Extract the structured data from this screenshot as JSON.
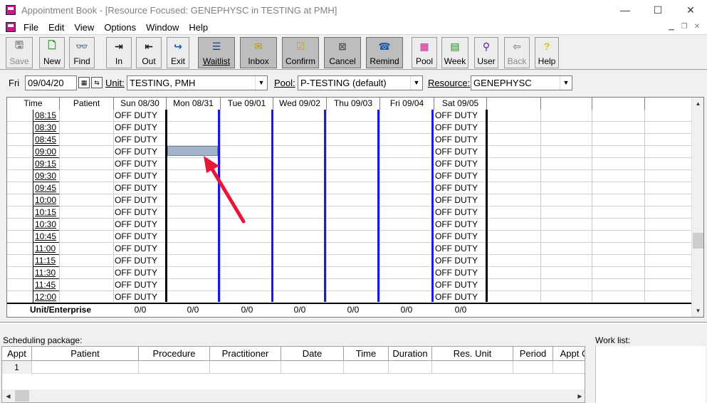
{
  "window": {
    "title": "Appointment Book - [Resource Focused:  GENEPHYSC in TESTING at PMH]",
    "minimize": "—",
    "maximize": "☐",
    "close": "✕"
  },
  "menu": [
    "File",
    "Edit",
    "View",
    "Options",
    "Window",
    "Help"
  ],
  "toolbar": [
    {
      "label": "Save",
      "icon": "save-icon",
      "state": "disabled"
    },
    {
      "label": "New",
      "icon": "new-icon",
      "state": "normal"
    },
    {
      "label": "Find",
      "icon": "binoculars-icon",
      "state": "normal"
    },
    {
      "label": "In",
      "icon": "check-in-icon",
      "state": "normal"
    },
    {
      "label": "Out",
      "icon": "check-out-icon",
      "state": "normal"
    },
    {
      "label": "Exit",
      "icon": "exit-icon",
      "state": "normal"
    },
    {
      "label": "Waitlist",
      "icon": "waitlist-icon",
      "state": "pressed"
    },
    {
      "label": "Inbox",
      "icon": "inbox-icon",
      "state": "pressed"
    },
    {
      "label": "Confirm",
      "icon": "confirm-icon",
      "state": "pressed"
    },
    {
      "label": "Cancel",
      "icon": "cancel-icon",
      "state": "pressed"
    },
    {
      "label": "Remind",
      "icon": "remind-icon",
      "state": "pressed"
    },
    {
      "label": "Pool",
      "icon": "pool-icon",
      "state": "normal"
    },
    {
      "label": "Week",
      "icon": "week-icon",
      "state": "normal"
    },
    {
      "label": "User",
      "icon": "user-icon",
      "state": "normal"
    },
    {
      "label": "Back",
      "icon": "back-icon",
      "state": "disabled"
    },
    {
      "label": "Help",
      "icon": "help-icon",
      "state": "normal"
    }
  ],
  "selection": {
    "day": "Fri",
    "date": "09/04/20",
    "unit_label": "Unit:",
    "unit_value": "TESTING, PMH",
    "pool_label": "Pool:",
    "pool_value": "P-TESTING (default)",
    "resource_label": "Resource:",
    "resource_value": "GENEPHYSC"
  },
  "grid": {
    "headers": [
      "Time",
      "Patient",
      "Sun 08/30",
      "Mon 08/31",
      "Tue 09/01",
      "Wed 09/02",
      "Thu 09/03",
      "Fri 09/04",
      "Sat 09/05",
      "",
      "",
      "",
      ""
    ],
    "times": [
      "08:15",
      "08:30",
      "08:45",
      "09:00",
      "09:15",
      "09:30",
      "09:45",
      "10:00",
      "10:15",
      "10:30",
      "10:45",
      "11:00",
      "11:15",
      "11:30",
      "11:45",
      "12:00"
    ],
    "off_duty": "OFF DUTY",
    "totals_label": "Unit/Enterprise",
    "totals": [
      "0/0",
      "0/0",
      "0/0",
      "0/0",
      "0/0",
      "0/0",
      "0/0"
    ],
    "selected_slot": {
      "day": "Mon 08/31",
      "time": "09:00"
    },
    "annotation": "red-arrow pointing to selected slot"
  },
  "scheduling": {
    "label": "Scheduling package:",
    "headers": [
      "Appt",
      "Patient",
      "Procedure",
      "Practitioner",
      "Date",
      "Time",
      "Duration",
      "Res. Unit",
      "Period",
      "Appt C"
    ],
    "row_number": "1"
  },
  "worklist": {
    "label": "Work list:"
  },
  "colors": {
    "blue_divider": "#1b1bd8",
    "selected_slot": "#a3b4c9",
    "arrow": "#e8173a"
  }
}
